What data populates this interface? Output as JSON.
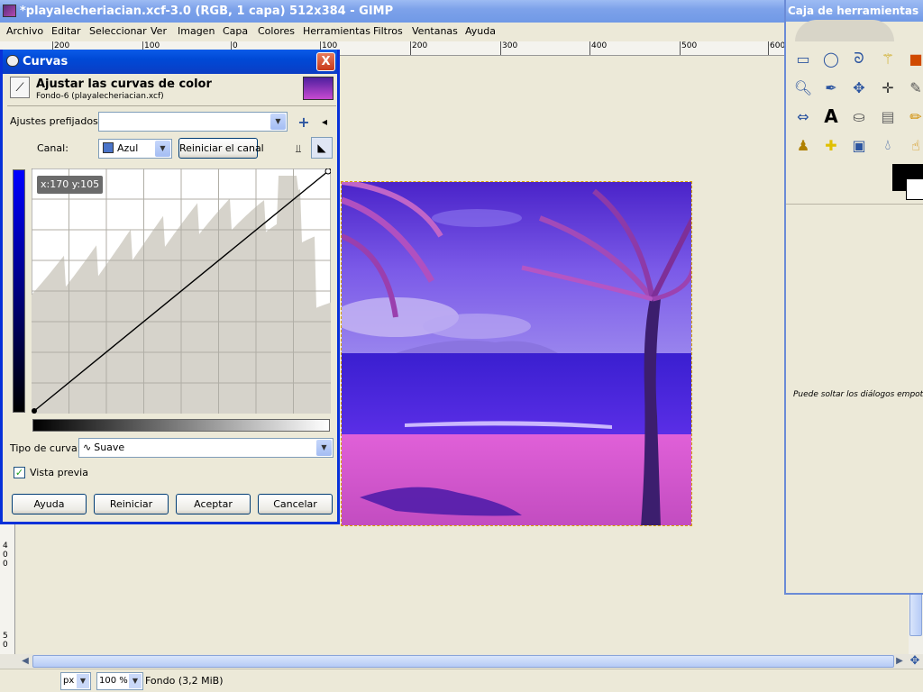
{
  "window": {
    "title": "*playalecheriacian.xcf-3.0 (RGB, 1 capa) 512x384 - GIMP"
  },
  "menu": [
    "Archivo",
    "Editar",
    "Seleccionar",
    "Ver",
    "Imagen",
    "Capa",
    "Colores",
    "Herramientas",
    "Filtros",
    "Ventanas",
    "Ayuda"
  ],
  "ruler_top": [
    "200",
    "100",
    "0",
    "100",
    "200",
    "300",
    "400",
    "500",
    "600"
  ],
  "ruler_left": [
    "4",
    "0",
    "0",
    "5",
    "0"
  ],
  "status": {
    "unit": "px",
    "zoom": "100 %",
    "layer_info": "Fondo (3,2 MiB)"
  },
  "toolbox": {
    "title": "Caja de herramientas",
    "drop_hint": "Puede soltar los diálogos empotrables",
    "tools": [
      "rect-select-icon",
      "ellipse-select-icon",
      "lasso-icon",
      "fuzzy-select-icon",
      "color-select-icon",
      "zoom-icon",
      "paths-icon",
      "move-icon",
      "align-icon",
      "measure-icon",
      "flip-icon",
      "text-icon",
      "bucket-fill-icon",
      "blend-icon",
      "pencil-icon",
      "clone-icon",
      "heal-icon",
      "perspective-clone-icon",
      "blur-icon",
      "smudge-icon"
    ],
    "fg_color": "#000000",
    "bg_color": "#ffffff"
  },
  "curves": {
    "title": "Curvas",
    "close": "X",
    "heading": "Ajustar las curvas de color",
    "subheading": "Fondo-6 (playalecheriacian.xcf)",
    "presets_label": "Ajustes prefijados:",
    "presets_value": "",
    "channel_label": "Canal:",
    "channel_value": "Azul",
    "reset_channel": "Reiniciar el canal",
    "coords": "x:170 y:105",
    "curve_type_label": "Tipo de curva:",
    "curve_type_value": "Suave",
    "preview_label": "Vista previa",
    "preview_checked": true,
    "buttons": {
      "help": "Ayuda",
      "reset": "Reiniciar",
      "ok": "Aceptar",
      "cancel": "Cancelar"
    },
    "channel_color": "#0000ff"
  }
}
